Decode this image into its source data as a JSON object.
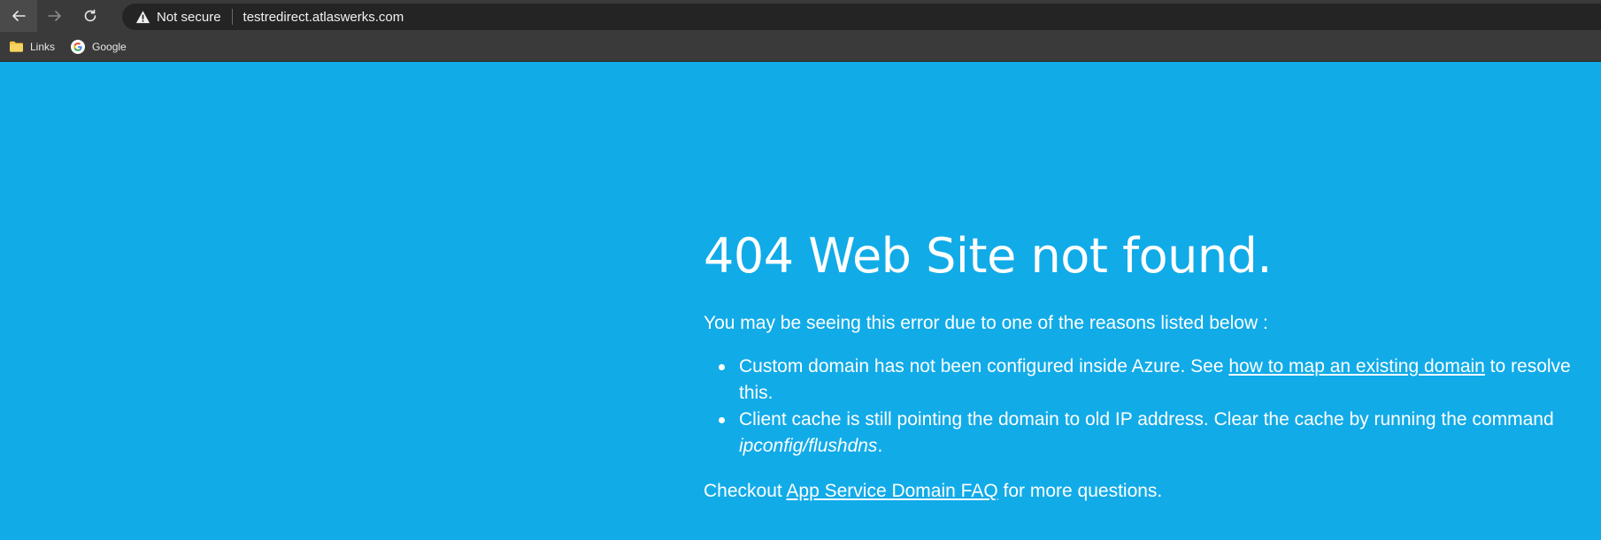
{
  "browser": {
    "security_label": "Not secure",
    "url": "testredirect.atlaswerks.com",
    "bookmarks": [
      {
        "label": "Links",
        "icon": "folder-icon"
      },
      {
        "label": "Google",
        "icon": "google-icon"
      }
    ]
  },
  "page": {
    "heading": "404 Web Site not found.",
    "intro": "You may be seeing this error due to one of the reasons listed below :",
    "reason1": {
      "before": "Custom domain has not been configured inside Azure. See ",
      "link": "how to map an existing domain",
      "after": " to resolve this."
    },
    "reason2": {
      "before": "Client cache is still pointing the domain to old IP address. Clear the cache by running the command ",
      "command": "ipconfig/flushdns",
      "after": "."
    },
    "faq": {
      "before": "Checkout ",
      "link": "App Service Domain FAQ",
      "after": " for more questions."
    }
  },
  "colors": {
    "page_background": "#11abe8",
    "chrome_toolbar": "#3a3a3a",
    "omnibox": "#242424",
    "text": "#ffffff",
    "folder": "#f4c542"
  }
}
